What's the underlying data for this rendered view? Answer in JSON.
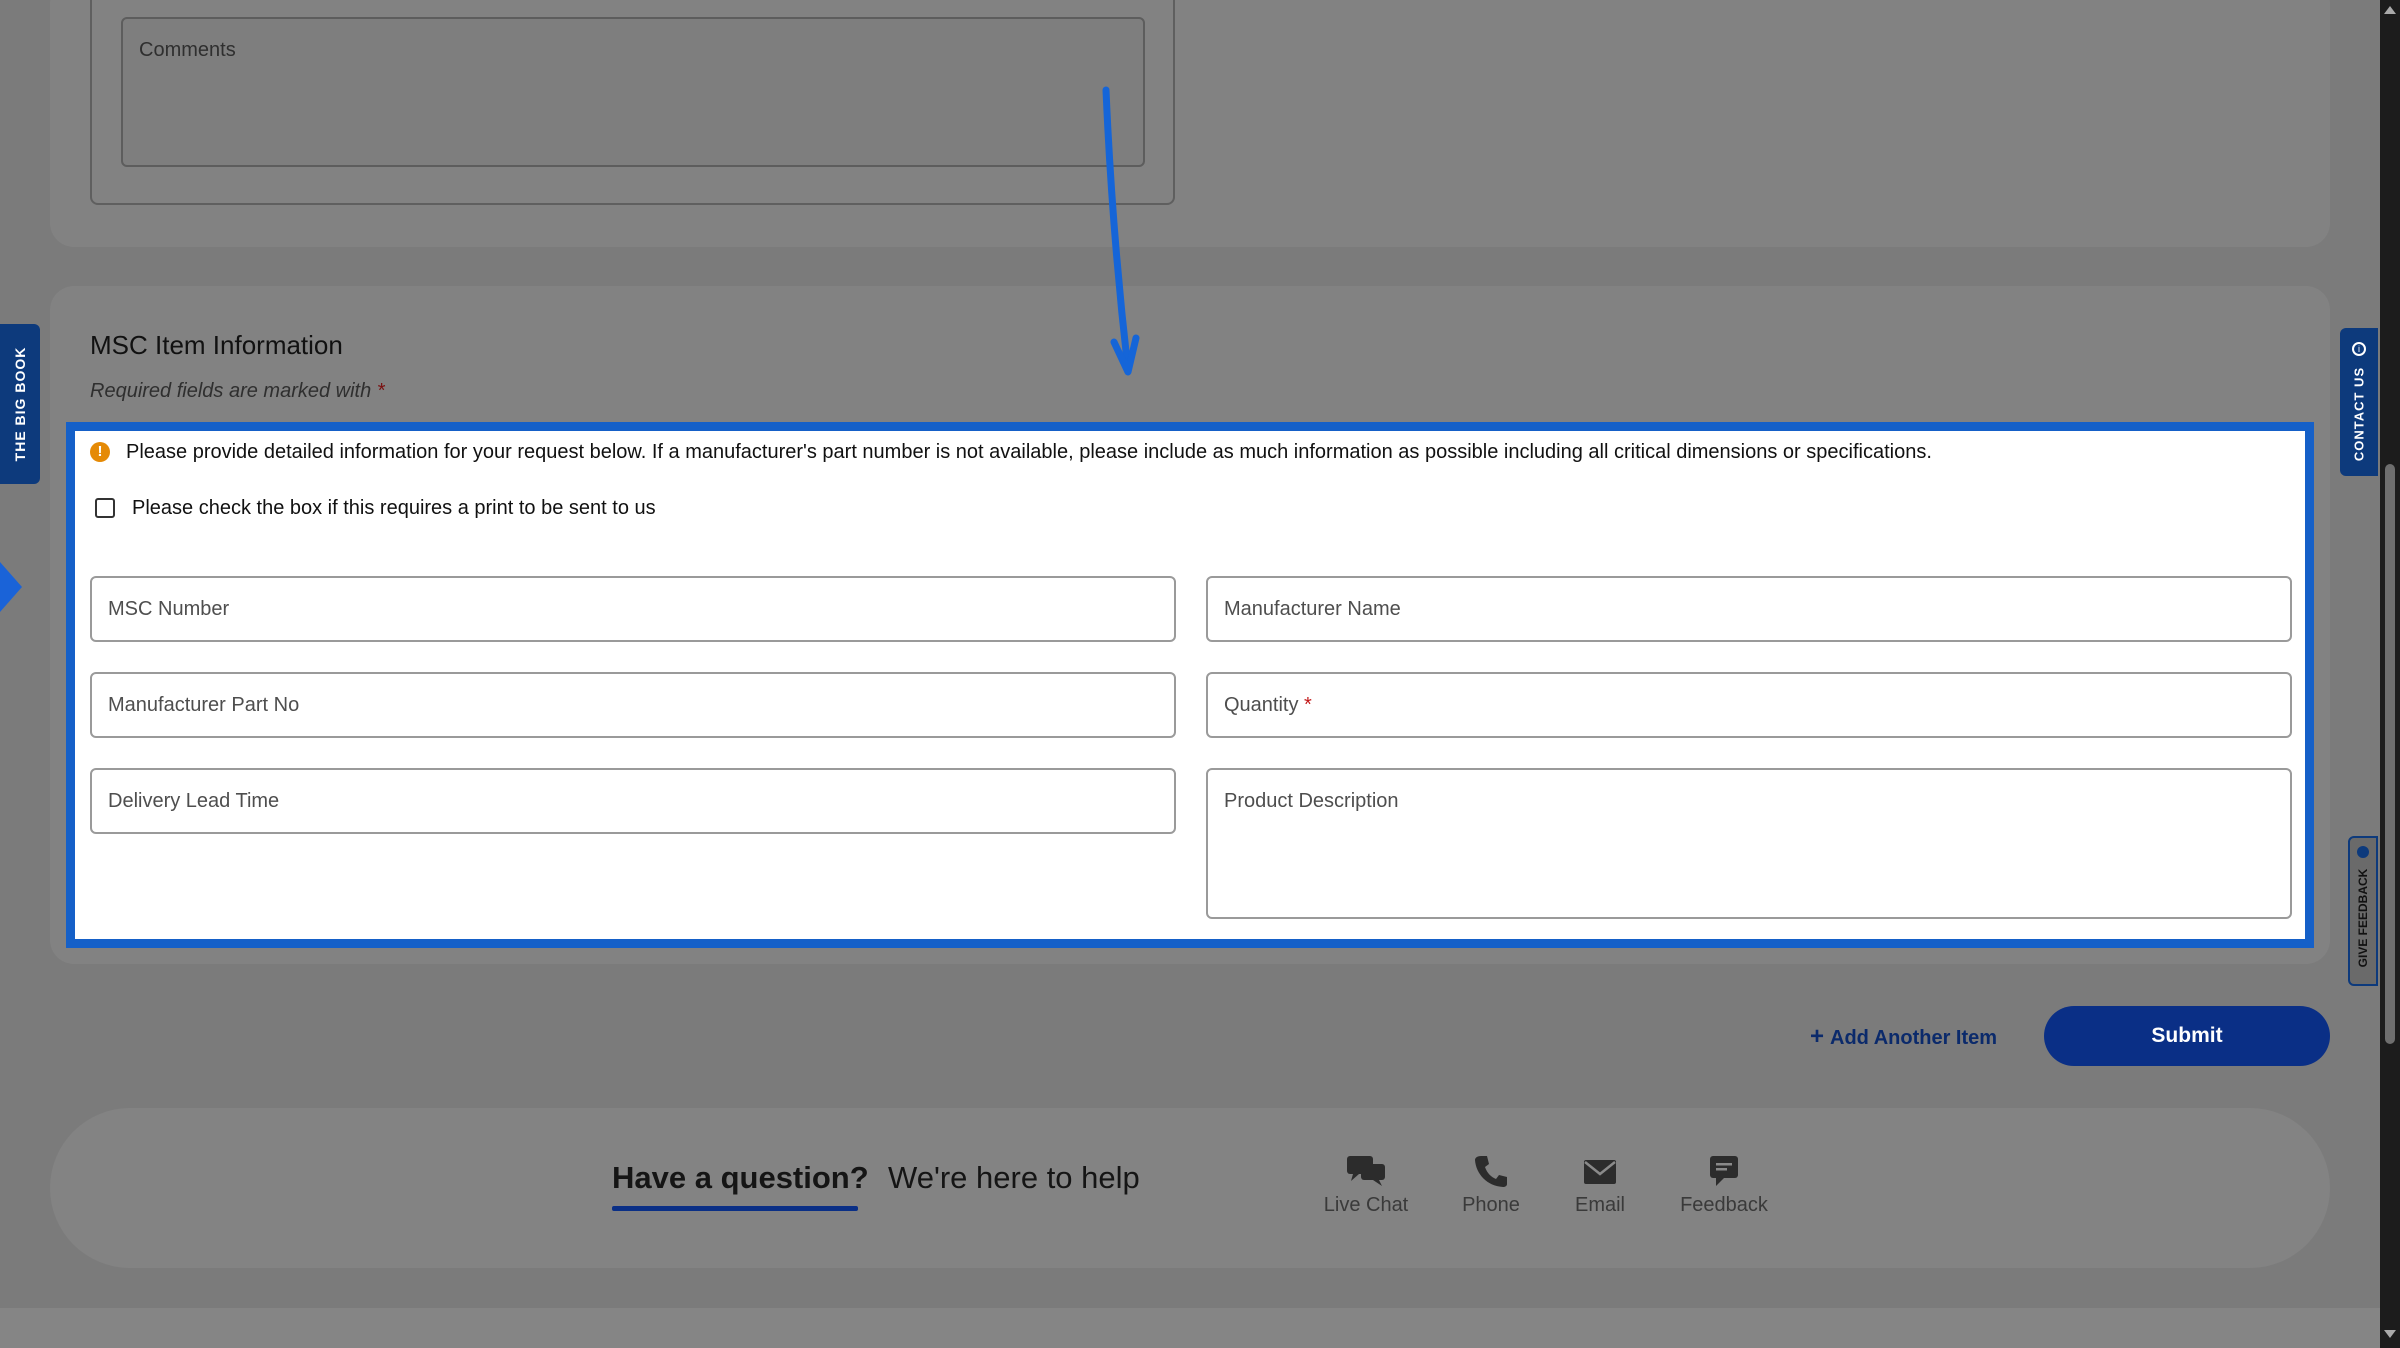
{
  "comments": {
    "placeholder": "Comments"
  },
  "item_section": {
    "title": "MSC Item Information",
    "required_note": "Required fields are marked with",
    "required_star": "*",
    "info_text": "Please provide detailed information for your request below. If a manufacturer's part number is not available, please include as much information as possible including all critical dimensions or specifications.",
    "checkbox_label": "Please check the box if this requires a print to be sent to us",
    "fields": {
      "msc_number": "MSC Number",
      "manufacturer_name": "Manufacturer Name",
      "manufacturer_part_no": "Manufacturer Part No",
      "quantity": "Quantity",
      "quantity_star": "*",
      "delivery_lead_time": "Delivery Lead Time",
      "product_description": "Product Description"
    }
  },
  "actions": {
    "add_item": "Add Another Item",
    "add_item_icon": "+",
    "submit": "Submit"
  },
  "help": {
    "question": "Have a question?",
    "subtitle": "We're here to help",
    "items": [
      {
        "label": "Live Chat",
        "icon": "chat-icon"
      },
      {
        "label": "Phone",
        "icon": "phone-icon"
      },
      {
        "label": "Email",
        "icon": "email-icon"
      },
      {
        "label": "Feedback",
        "icon": "feedback-icon"
      }
    ]
  },
  "side_tabs": {
    "big_book": "THE BIG BOOK",
    "contact_us": "CONTACT US",
    "give_feedback": "GIVE FEEDBACK"
  },
  "colors": {
    "highlight_border": "#1560c8",
    "submit_bg": "#0a2f86",
    "info_icon": "#e58a06",
    "required_star": "#c21818"
  }
}
